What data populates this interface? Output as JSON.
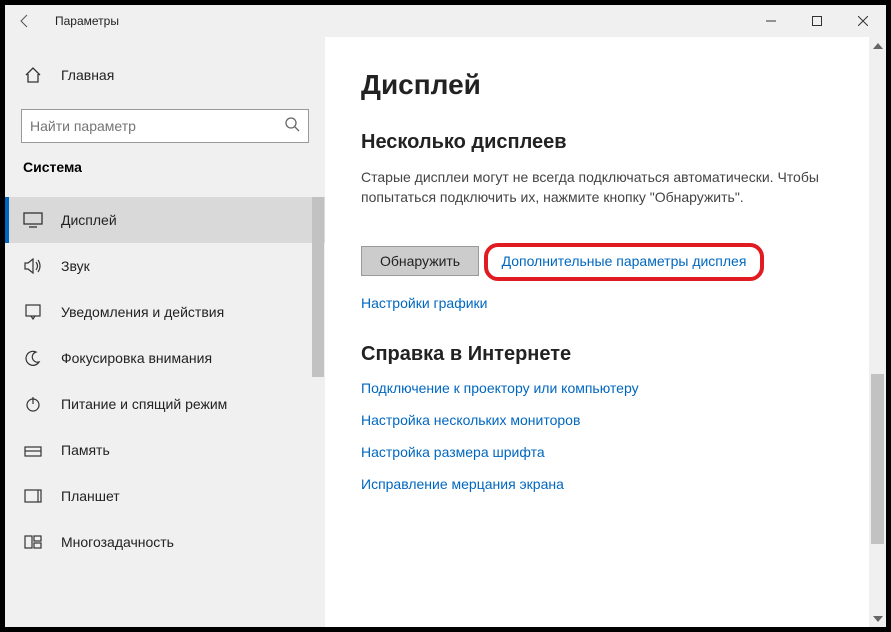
{
  "window": {
    "title": "Параметры"
  },
  "sidebar": {
    "home": "Главная",
    "search_placeholder": "Найти параметр",
    "category": "Система",
    "items": [
      {
        "label": "Дисплей"
      },
      {
        "label": "Звук"
      },
      {
        "label": "Уведомления и действия"
      },
      {
        "label": "Фокусировка внимания"
      },
      {
        "label": "Питание и спящий режим"
      },
      {
        "label": "Память"
      },
      {
        "label": "Планшет"
      },
      {
        "label": "Многозадачность"
      }
    ]
  },
  "main": {
    "title": "Дисплей",
    "multi": {
      "heading": "Несколько дисплеев",
      "text": "Старые дисплеи могут не всегда подключаться автоматически. Чтобы попытаться подключить их, нажмите кнопку \"Обнаружить\".",
      "detect_btn": "Обнаружить",
      "adv_link": "Дополнительные параметры дисплея",
      "gfx_link": "Настройки графики"
    },
    "help": {
      "heading": "Справка в Интернете",
      "links": [
        "Подключение к проектору или компьютеру",
        "Настройка нескольких мониторов",
        "Настройка размера шрифта",
        "Исправление мерцания экрана"
      ]
    }
  }
}
